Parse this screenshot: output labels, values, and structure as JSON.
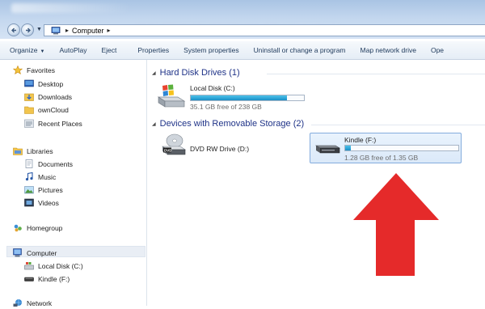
{
  "address": {
    "path": [
      "Computer"
    ]
  },
  "toolbar": {
    "items": [
      "Organize",
      "AutoPlay",
      "Eject",
      "Properties",
      "System properties",
      "Uninstall or change a program",
      "Map network drive",
      "Ope"
    ]
  },
  "nav": {
    "favorites": "Favorites",
    "desktop": "Desktop",
    "downloads": "Downloads",
    "owncloud": "ownCloud",
    "recent": "Recent Places",
    "libraries": "Libraries",
    "documents": "Documents",
    "music": "Music",
    "pictures": "Pictures",
    "videos": "Videos",
    "homegroup": "Homegroup",
    "computer": "Computer",
    "local_disk": "Local Disk (C:)",
    "kindle": "Kindle (F:)",
    "network": "Network"
  },
  "groups": {
    "hdd": "Hard Disk Drives (1)",
    "removable": "Devices with Removable Storage (2)"
  },
  "drives": {
    "local": {
      "name": "Local Disk (C:)",
      "free": "35.1 GB free of 238 GB",
      "used_fraction": 0.85
    },
    "dvd": {
      "name": "DVD RW Drive (D:)",
      "label": "DVD"
    },
    "kindle": {
      "name": "Kindle (F:)",
      "free": "1.28 GB free of 1.35 GB",
      "used_fraction": 0.05
    }
  },
  "colors": {
    "group_header": "#1e3287",
    "selection": "#dbe9f9",
    "bar_fill": "#1a8fc7",
    "annotation_arrow": "#e52a2a"
  }
}
